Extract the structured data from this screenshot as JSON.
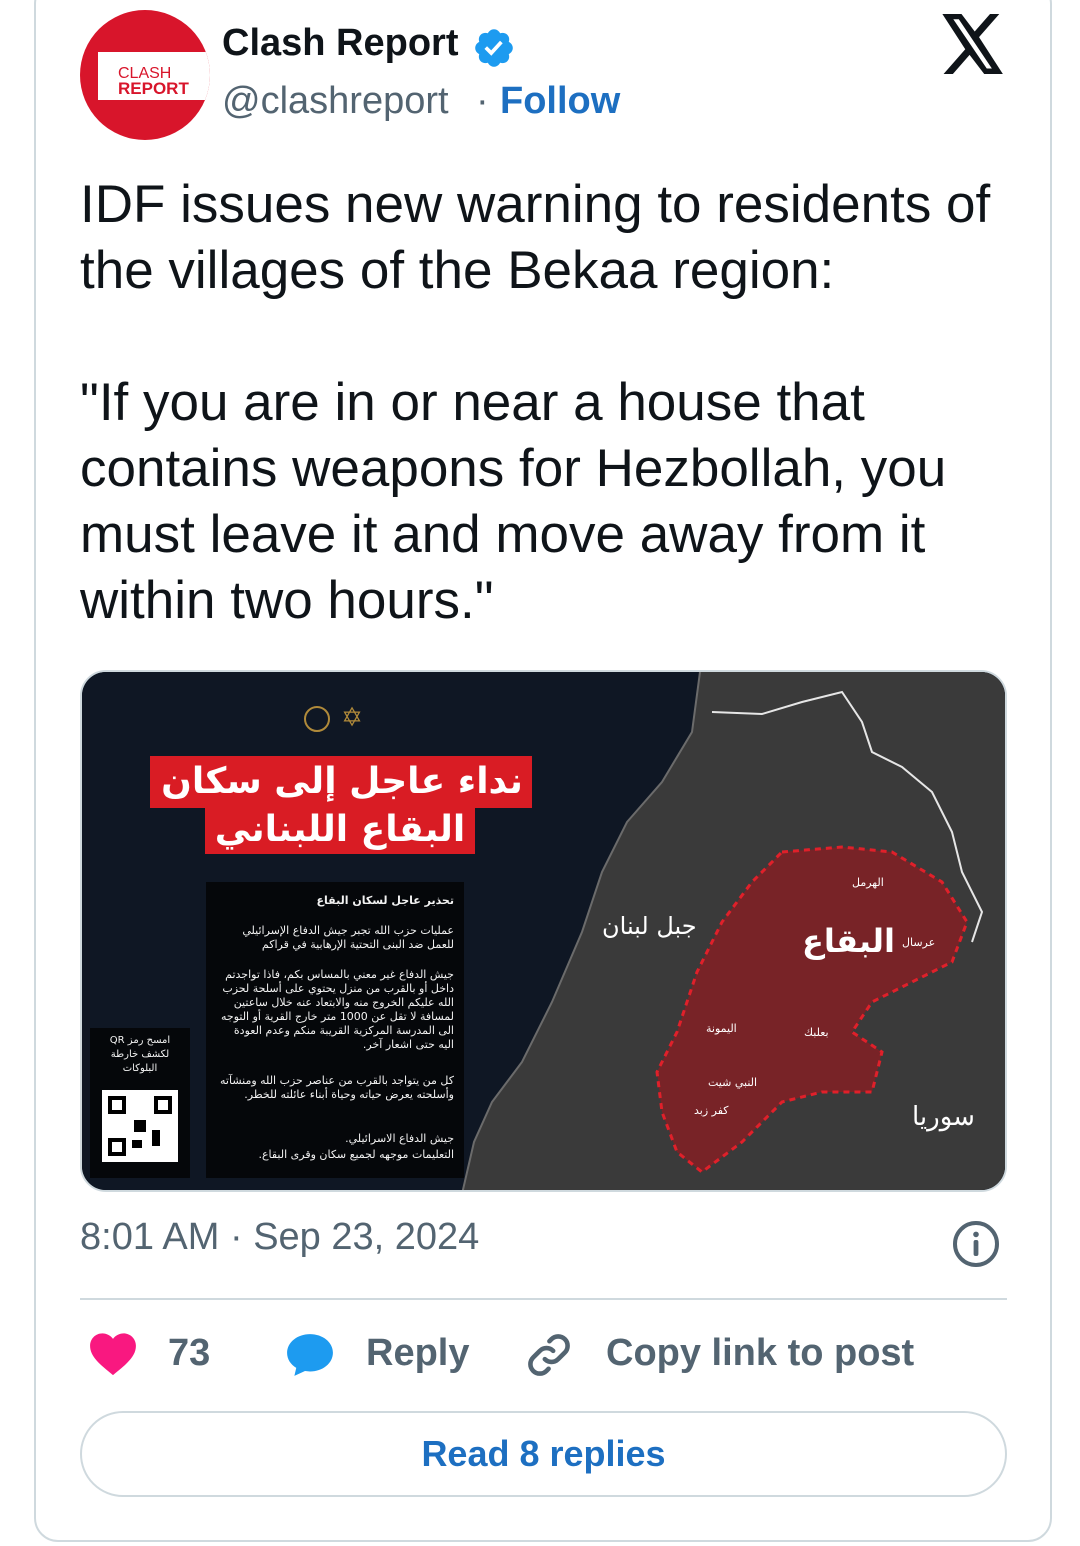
{
  "author": {
    "avatar_line1": "CLASH",
    "avatar_line2": "REPORT",
    "name": "Clash Report",
    "handle": "@clashreport",
    "separator": "·",
    "follow_label": "Follow",
    "verified_icon": "verified-badge-icon"
  },
  "platform_icon": "x-logo-icon",
  "tweet": {
    "paragraph1": "IDF issues new warning to residents of the villages of the Bekaa region:",
    "paragraph2": "\"If you are in or near a house that contains weapons for Hezbollah, you must leave it and move away from it within two hours.\""
  },
  "media": {
    "headline_line1": "نداء عاجل إلى سكان",
    "headline_line2": "البقاع اللبناني",
    "doc_title": "تحذير عاجل لسكان البقاع",
    "doc_par1": "عمليات حزب الله تجبر جيش الدفاع الإسرائيلي للعمل ضد البنى التحتية الإرهابية في قراكم",
    "doc_par2": "جيش الدفاع غير معني بالمساس بكم، فاذا تواجدتم داخل أو بالقرب من منزل يحتوي على أسلحة لحزب الله عليكم الخروج منه والابتعاد عنه خلال ساعتين لمسافة لا تقل عن 1000 متر خارج القرية أو التوجه الى المدرسة المركزية القريبة منكم وعدم العودة اليه حتى اشعار آخر.",
    "doc_par3": "كل من يتواجد بالقرب من عناصر حزب الله ومنشآته وأسلحته يعرض حياته وحياة أبناء عائلته للخطر.",
    "doc_sign1": "جيش الدفاع الاسرائيلي.",
    "doc_sign2": "التعليمات موجهه لجميع سكان وقرى البقاع.",
    "qr_caption": "امسح رمز QR لكشف خارطة البلوكات",
    "map_label_mountain": "جبل لبنان",
    "map_label_bekaa": "البقاع",
    "map_label_syria": "سوريا",
    "map_label_hermel": "الهرمل",
    "map_label_arsal": "عرسال",
    "map_label_baalbek": "بعلبك",
    "map_label_yammouneh": "اليمونة",
    "map_label_nabi_chit": "النبي شيت",
    "map_label_kfar_zabad": "كفر زبد",
    "zone_color": "#e0202a",
    "headline_color": "#d91c24"
  },
  "timestamp": "8:01 AM · Sep 23, 2024",
  "actions": {
    "like_count": "73",
    "reply_label": "Reply",
    "copy_link_label": "Copy link to post"
  },
  "read_replies_label": "Read 8 replies",
  "colors": {
    "link_blue": "#1d6fc1",
    "heart_pink": "#f91880",
    "reply_blue": "#1d9bf0",
    "muted_gray": "#536471"
  }
}
